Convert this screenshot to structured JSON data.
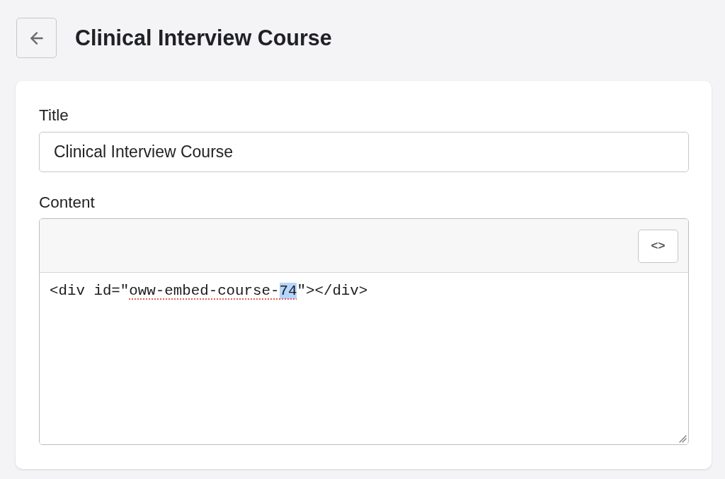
{
  "header": {
    "title": "Clinical Interview Course"
  },
  "title_field": {
    "label": "Title",
    "value": "Clinical Interview Course"
  },
  "content_field": {
    "label": "Content",
    "toolbar_button": "<>",
    "code": [
      {
        "text": "<div id=\"",
        "misspelled": false,
        "selected": false
      },
      {
        "text": "oww-embed-course-",
        "misspelled": true,
        "selected": false
      },
      {
        "text": "74",
        "misspelled": true,
        "selected": true
      },
      {
        "text": "\"></div>",
        "misspelled": false,
        "selected": false
      }
    ]
  }
}
